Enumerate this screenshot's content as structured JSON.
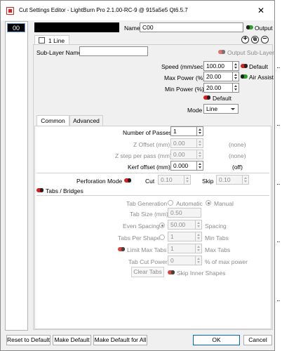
{
  "window": {
    "title": "Cut Settings Editor - LightBurn Pro 2.1.00-RC-9 @ 915a5e5 Qt6.5.7",
    "close_glyph": "✕"
  },
  "layer": {
    "number": "00",
    "name_label": "Name",
    "name_value": "C00",
    "output_label": "Output",
    "sub_tab_label": "1 Line",
    "sublayer_name_label": "Sub-Layer Name",
    "sublayer_name_value": "",
    "output_sublayer_label": "Output Sub-Layer"
  },
  "power": {
    "speed_label": "Speed (mm/sec)",
    "speed_value": "100.00",
    "default_label": "Default",
    "max_power_label": "Max Power (%)",
    "max_power_value": "20.00",
    "air_assist_label": "Air Assist",
    "min_power_label": "Min Power (%)",
    "min_power_value": "20.00",
    "default2_label": "Default",
    "mode_label": "Mode",
    "mode_value": "Line"
  },
  "tabs": [
    {
      "label": "Common"
    },
    {
      "label": "Advanced"
    }
  ],
  "common": {
    "passes_label": "Number of Passes",
    "passes_value": "1",
    "z_offset_label": "Z Offset (mm)",
    "z_offset_value": "0.00",
    "z_offset_note": "(none)",
    "z_step_label": "Z step per pass (mm)",
    "z_step_value": "0.00",
    "z_step_note": "(none)",
    "kerf_label": "Kerf offset (mm)",
    "kerf_value": "0.000",
    "kerf_note": "(off)",
    "perforation_label": "Perforation Mode",
    "cut_label": "Cut",
    "cut_value": "0.10",
    "skip_label": "Skip",
    "skip_value": "0.10",
    "tabs_bridges_label": "Tabs / Bridges",
    "tab_gen_label": "Tab Generation",
    "automatic_label": "Automatic",
    "manual_label": "Manual",
    "tab_size_label": "Tab Size (mm)",
    "tab_size_value": "0.50",
    "even_spacing_label": "Even Spacing",
    "even_spacing_value": "50.00",
    "spacing_label": "Spacing",
    "tabs_per_shape_label": "Tabs Per Shape",
    "tabs_per_shape_value": "1",
    "min_tabs_label": "Min Tabs",
    "limit_max_tabs_label": "Limit Max Tabs",
    "limit_max_tabs_value": "1",
    "max_tabs_label": "Max Tabs",
    "tab_cut_power_label": "Tab Cut Power",
    "tab_cut_power_value": "0",
    "pct_max_power_label": "% of max power",
    "clear_tabs_label": "Clear Tabs",
    "skip_inner_label": "Skip Inner Shapes"
  },
  "footer": {
    "reset_label": "Reset to Default",
    "make_default_label": "Make Default",
    "make_default_all_label": "Make Default for All",
    "ok_label": "OK",
    "cancel_label": "Cancel"
  },
  "icons": {
    "add": "+",
    "duplicate": "⧉",
    "remove": "−"
  },
  "colors": {
    "toggle_on": "#2ca02c",
    "toggle_off": "#d42020",
    "primary_border": "#0067c0"
  }
}
